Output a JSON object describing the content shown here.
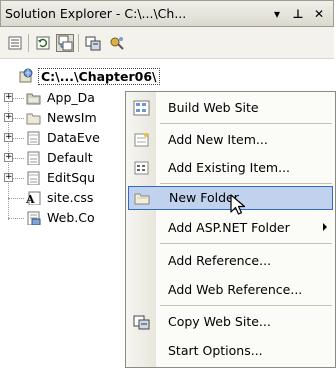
{
  "titlebar": {
    "title": "Solution Explorer - C:\\...\\Ch...",
    "dropdown_glyph": "▾",
    "pin_glyph": "⊥",
    "close_glyph": "✕"
  },
  "toolbar": {
    "buttons": [
      "properties-icon",
      "refresh-icon",
      "nest-related-icon",
      "copy-website-icon",
      "asp-net-config-icon"
    ]
  },
  "tree": {
    "root": {
      "label": "C:\\...\\Chapter06\\",
      "icon": "website-icon"
    },
    "items": [
      {
        "label": "App_Da",
        "icon": "special-folder-icon",
        "expandable": true
      },
      {
        "label": "NewsIm",
        "icon": "folder-icon",
        "expandable": true
      },
      {
        "label": "DataEve",
        "icon": "page-icon",
        "expandable": true
      },
      {
        "label": "Default",
        "icon": "page-icon",
        "expandable": true
      },
      {
        "label": "EditSqu",
        "icon": "page-icon",
        "expandable": true
      },
      {
        "label": "site.css",
        "icon": "stylesheet-icon",
        "expandable": false
      },
      {
        "label": "Web.Co",
        "icon": "config-icon",
        "expandable": false
      }
    ]
  },
  "context_menu": {
    "items": [
      {
        "label": "Build Web Site",
        "icon": "build-icon"
      },
      {
        "label": "Add New Item...",
        "icon": "add-new-item-icon"
      },
      {
        "label": "Add Existing Item...",
        "icon": "add-existing-item-icon"
      },
      {
        "label": "New Folder",
        "icon": "new-folder-icon",
        "highlighted": true
      },
      {
        "label": "Add ASP.NET Folder",
        "submenu": true
      },
      {
        "label": "Add Reference..."
      },
      {
        "label": "Add Web Reference..."
      },
      {
        "label": "Copy Web Site...",
        "icon": "copy-website-icon"
      },
      {
        "label": "Start Options..."
      }
    ]
  }
}
